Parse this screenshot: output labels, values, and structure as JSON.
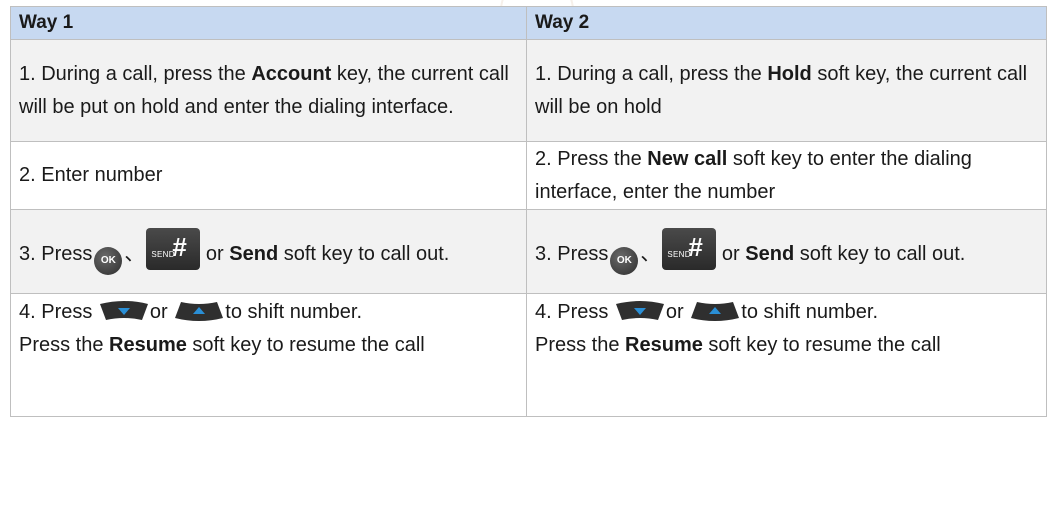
{
  "headers": {
    "way1": "Way 1",
    "way2": "Way 2"
  },
  "rows": {
    "r1": {
      "w1": [
        "1. During a call, press the ",
        "Account",
        " key, the current call will be put on hold and enter the dialing interface."
      ],
      "w2": [
        "1. During a call, press the ",
        "Hold",
        " soft key, the current call will be on hold"
      ]
    },
    "r2": {
      "w1": [
        "2. Enter number"
      ],
      "w2": [
        "2. Press the ",
        "New call",
        " soft key to enter the dialing interface, enter the number"
      ]
    },
    "r3": {
      "w1": [
        "3. Press",
        "、",
        "or ",
        "Send",
        " soft key to call out."
      ],
      "w2": [
        "3. Press",
        "、",
        "or ",
        "Send",
        " soft key to call out."
      ]
    },
    "r4": {
      "w1": [
        "4. Press ",
        "or ",
        "to shift number.",
        "Press the ",
        "Resume",
        " soft key to resume the call"
      ],
      "w2": [
        "4. Press ",
        "or ",
        "to shift number.",
        "Press the ",
        "Resume",
        " soft key to resume the call"
      ]
    }
  },
  "keys": {
    "ok_label": "OK",
    "send_small": "SEND",
    "send_hash": "#"
  },
  "icons": {
    "ok": "ok-key-icon",
    "send": "send-key-icon",
    "down": "down-arrow-key-icon",
    "up": "up-arrow-key-icon"
  },
  "colors": {
    "header_bg": "#c7d9f1",
    "shade_bg": "#f2f2f2",
    "border": "#bfbfbf"
  }
}
